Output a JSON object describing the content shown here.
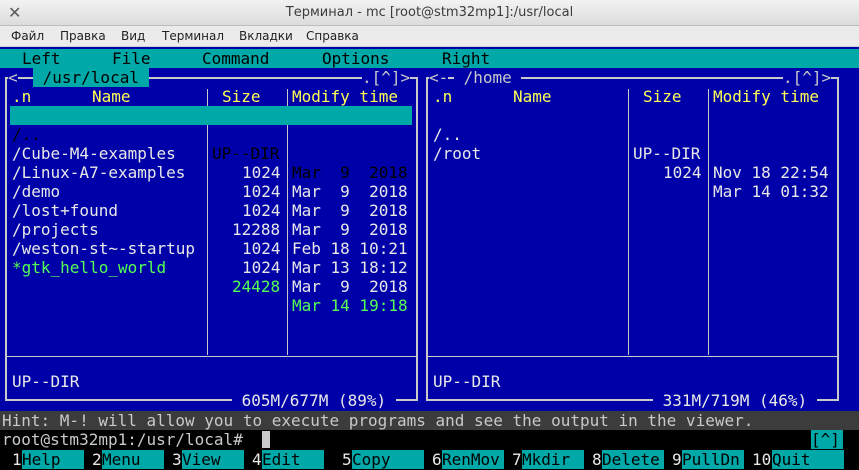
{
  "window": {
    "title": "Терминал - mc [root@stm32mp1]:/usr/local",
    "close_glyph": "✕"
  },
  "app_menu": [
    "Файл",
    "Правка",
    "Вид",
    "Терминал",
    "Вкладки",
    "Справка"
  ],
  "mc_menu": [
    "Left",
    "File",
    "Command",
    "Options",
    "Right"
  ],
  "left_panel": {
    "path": " /usr/local ",
    "corner_left": "<",
    "corner_right": ".[^]>",
    "columns": {
      "n": ".n",
      "name": "Name",
      "size": "Size",
      "modify": "Modify time"
    },
    "rows": [
      {
        "name": "/..",
        "size": "UP--DIR",
        "date": "Mar  9  2018",
        "selected": true,
        "exec": false
      },
      {
        "name": "/Cube-M4-examples",
        "size": "1024",
        "date": "Mar  9  2018",
        "selected": false,
        "exec": false
      },
      {
        "name": "/Linux-A7-examples",
        "size": "1024",
        "date": "Mar  9  2018",
        "selected": false,
        "exec": false
      },
      {
        "name": "/demo",
        "size": "1024",
        "date": "Mar  9  2018",
        "selected": false,
        "exec": false
      },
      {
        "name": "/lost+found",
        "size": "12288",
        "date": "Feb 18 10:21",
        "selected": false,
        "exec": false
      },
      {
        "name": "/projects",
        "size": "1024",
        "date": "Mar 13 18:12",
        "selected": false,
        "exec": false
      },
      {
        "name": "/weston-st~-startup",
        "size": "1024",
        "date": "Mar  9  2018",
        "selected": false,
        "exec": false
      },
      {
        "name": "*gtk_hello_world",
        "size": "24428",
        "date": "Mar 14 19:18",
        "selected": false,
        "exec": true
      }
    ],
    "status": "UP--DIR",
    "disk": " 605M/677M (89%) "
  },
  "right_panel": {
    "path": " /home ",
    "corner_left": "<-",
    "corner_right": ".[^]>",
    "columns": {
      "n": ".n",
      "name": "Name",
      "size": "Size",
      "modify": "Modify time"
    },
    "rows": [
      {
        "name": "/..",
        "size": "UP--DIR",
        "date": "Nov 18 22:54"
      },
      {
        "name": "/root",
        "size": "1024",
        "date": "Mar 14 01:32"
      }
    ],
    "status": "UP--DIR",
    "disk": " 331M/719M (46%) "
  },
  "hint": "Hint: M-! will allow you to execute programs and see the output in the viewer.",
  "prompt": "root@stm32mp1:/usr/local#",
  "prompt_button": "[^]",
  "fkeys": [
    {
      "num": "1",
      "label": "Help"
    },
    {
      "num": "2",
      "label": "Menu"
    },
    {
      "num": "3",
      "label": "View"
    },
    {
      "num": "4",
      "label": "Edit"
    },
    {
      "num": "5",
      "label": "Copy"
    },
    {
      "num": "6",
      "label": "RenMov"
    },
    {
      "num": "7",
      "label": "Mkdir"
    },
    {
      "num": "8",
      "label": "Delete"
    },
    {
      "num": "9",
      "label": "PullDn"
    },
    {
      "num": "10",
      "label": "Quit"
    }
  ]
}
